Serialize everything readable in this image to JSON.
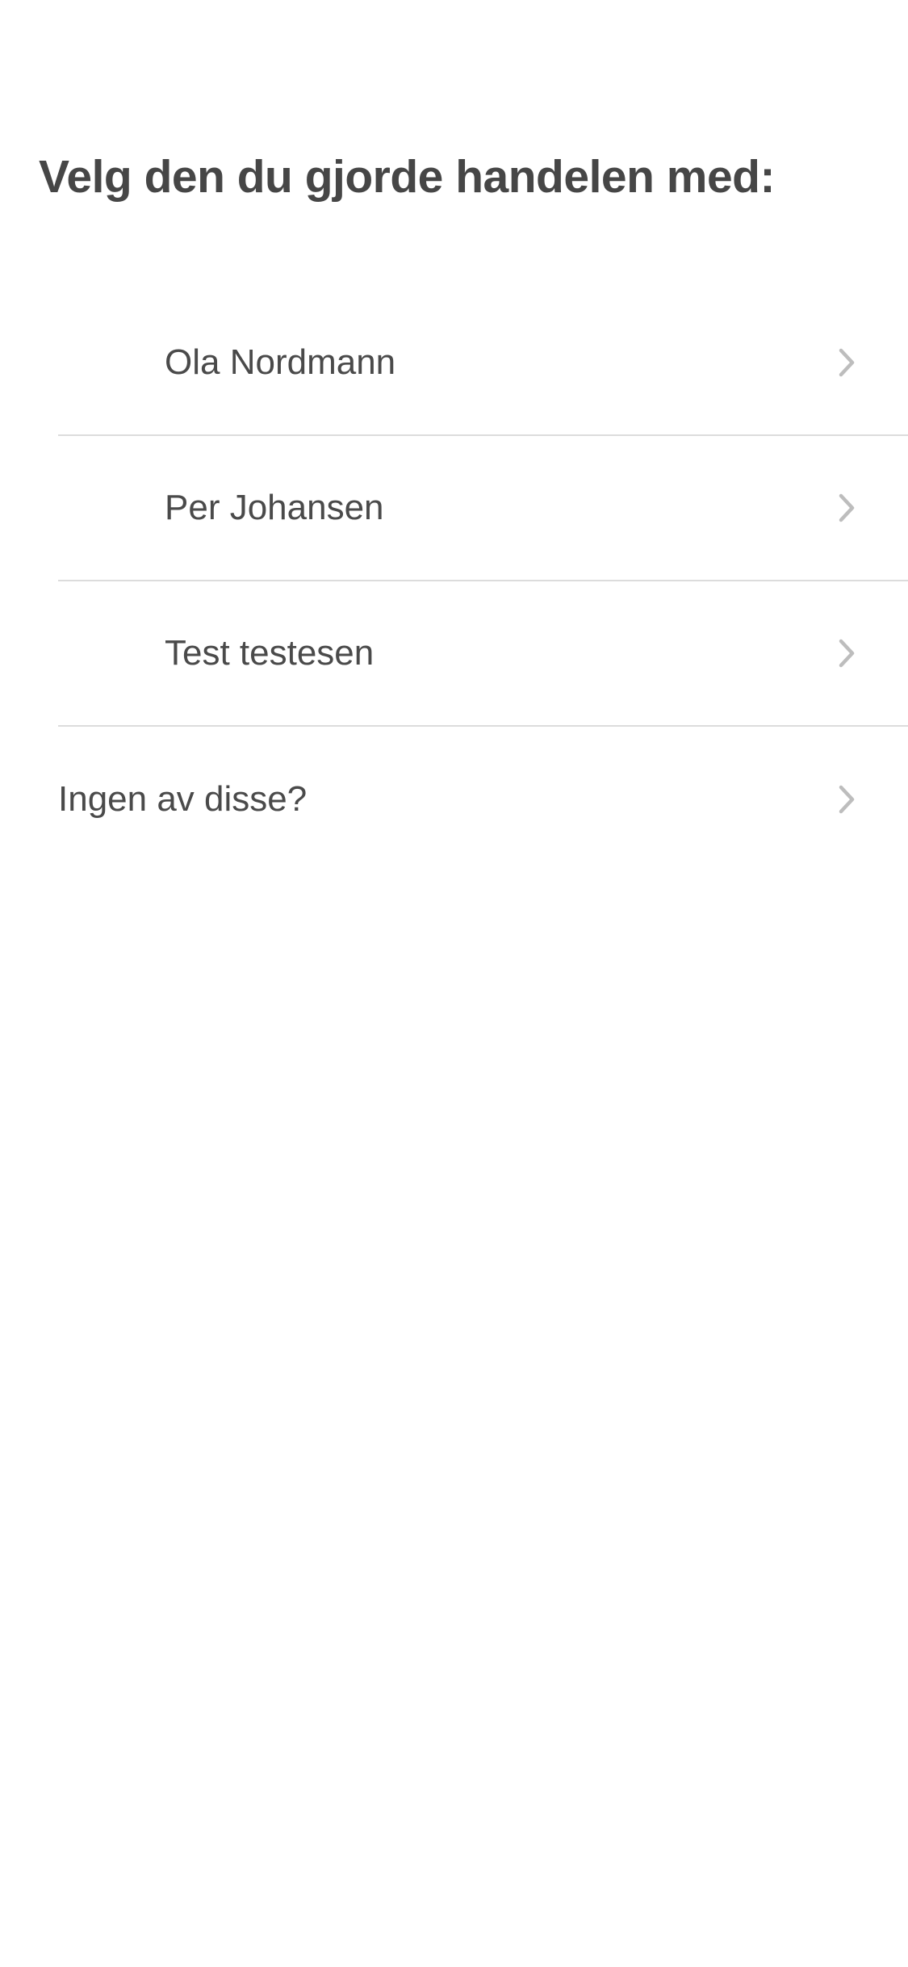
{
  "header": {
    "title": "Velg den du gjorde handelen med:"
  },
  "people": [
    {
      "name": "Ola Nordmann"
    },
    {
      "name": "Per Johansen"
    },
    {
      "name": "Test testesen"
    }
  ],
  "none_option": {
    "label": "Ingen av disse?"
  },
  "icons": {
    "row_chevron": "chevron-right-icon"
  },
  "colors": {
    "text": "#474747",
    "divider": "#dcdcdc",
    "chevron": "#bdbdbd",
    "background": "#ffffff"
  }
}
